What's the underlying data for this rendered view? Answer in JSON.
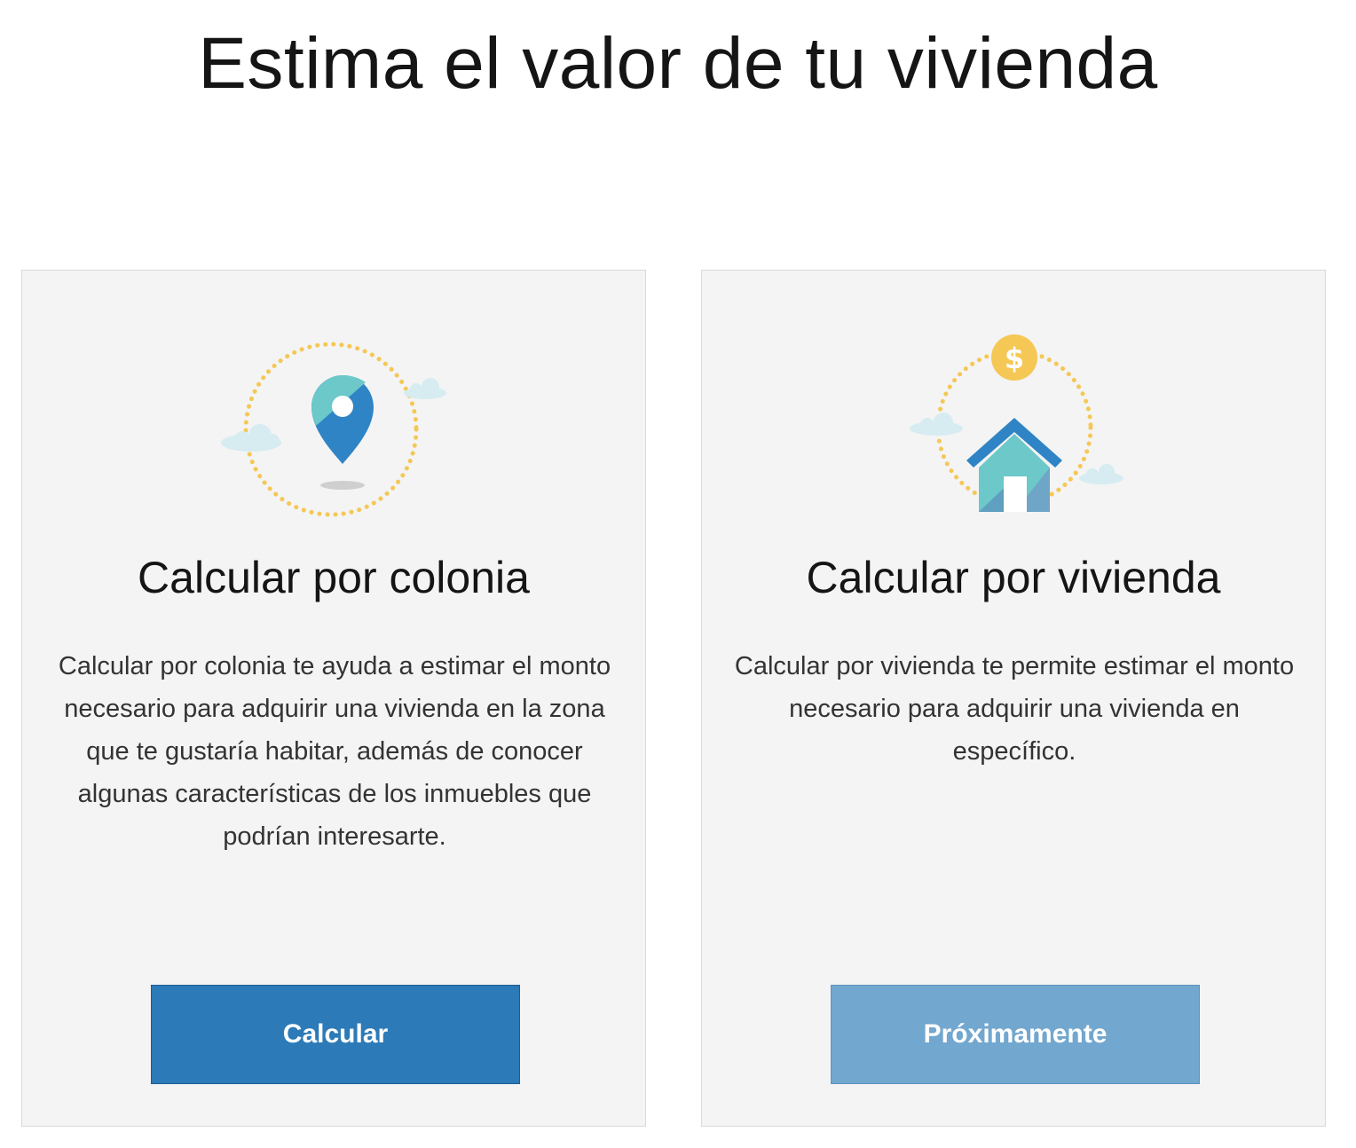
{
  "page": {
    "title": "Estima el valor de tu vivienda"
  },
  "cards": [
    {
      "illustration": "map-pin-icon",
      "title": "Calcular por colonia",
      "description": "Calcular por colonia te ayuda a estimar el monto necesario para adquirir una vivienda en la zona que te gustaría habitar, además de conocer algunas características de los inmuebles que podrían interesarte.",
      "button_label": "Calcular",
      "button_enabled": true
    },
    {
      "illustration": "house-with-coin-icon",
      "coin_symbol": "$",
      "title": "Calcular por vivienda",
      "description": "Calcular por vivienda te permite estimar el monto necesario para adquirir una vivienda en específico.",
      "button_label": "Próximamente",
      "button_enabled": false
    }
  ],
  "colors": {
    "primary_button": "#2c7ab7",
    "disabled_button": "#72a7cf",
    "card_background": "#f4f4f4",
    "dotted_ring": "#f5c754",
    "pin_teal": "#6cc8c9",
    "pin_blue": "#2f84c6",
    "cloud": "#d6ecf1"
  }
}
